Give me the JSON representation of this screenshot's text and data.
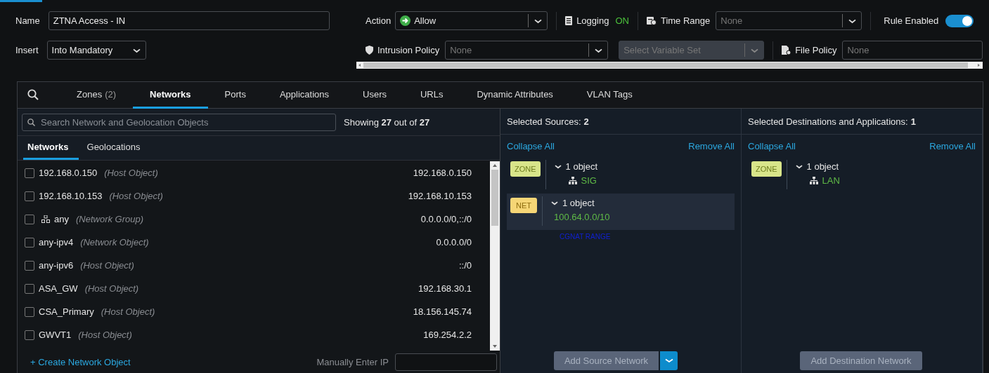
{
  "rule": {
    "name_label": "Name",
    "name": "ZTNA Access - IN",
    "insert_label": "Insert",
    "insert": "Into Mandatory",
    "action_label": "Action",
    "action": "Allow",
    "logging_label": "Logging",
    "logging": "ON",
    "time_range_label": "Time Range",
    "time_range_placeholder": "None",
    "rule_enabled_label": "Rule Enabled",
    "rule_enabled": true,
    "intrusion_label": "Intrusion Policy",
    "intrusion_placeholder": "None",
    "variable_set_placeholder": "Select Variable Set",
    "file_policy_label": "File Policy",
    "file_policy_placeholder": "None"
  },
  "tabs": [
    {
      "label": "Zones",
      "count": "(2)",
      "selected": false
    },
    {
      "label": "Networks",
      "selected": true
    },
    {
      "label": "Ports",
      "selected": false
    },
    {
      "label": "Applications",
      "selected": false
    },
    {
      "label": "Users",
      "selected": false
    },
    {
      "label": "URLs",
      "selected": false
    },
    {
      "label": "Dynamic Attributes",
      "selected": false
    },
    {
      "label": "VLAN Tags",
      "selected": false
    }
  ],
  "search": {
    "placeholder": "Search Network and Geolocation Objects"
  },
  "showing": "Showing **27** out of **27**",
  "subtabs": [
    {
      "label": "Networks",
      "selected": true
    },
    {
      "label": "Geolocations",
      "selected": false
    }
  ],
  "objects": [
    {
      "kind": "host",
      "name": "192.168.0.150",
      "type": "(Host Object)",
      "value": "192.168.0.150",
      "checked": false
    },
    {
      "kind": "host",
      "name": "192.168.10.153",
      "type": "(Host Object)",
      "value": "192.168.10.153",
      "checked": false
    },
    {
      "kind": "group",
      "name": "any",
      "type": "(Network Group)",
      "value": "0.0.0.0/0,::/0",
      "checked": false
    },
    {
      "kind": "host",
      "name": "any-ipv4",
      "type": "(Network Object)",
      "value": "0.0.0.0/0",
      "checked": false
    },
    {
      "kind": "host",
      "name": "any-ipv6",
      "type": "(Host Object)",
      "value": "::/0",
      "checked": false
    },
    {
      "kind": "host",
      "name": "ASA_GW",
      "type": "(Host Object)",
      "value": "192.168.30.1",
      "checked": false
    },
    {
      "kind": "host",
      "name": "CSA_Primary",
      "type": "(Host Object)",
      "value": "18.156.145.74",
      "checked": false
    },
    {
      "kind": "host",
      "name": "GWVT1",
      "type": "(Host Object)",
      "value": "169.254.2.2",
      "checked": false
    }
  ],
  "create_link": "+ Create Network Object",
  "manual_ip_label": "Manually Enter IP",
  "sources": {
    "title": "Selected Sources: **2**",
    "collapse": "Collapse All",
    "remove": "Remove All",
    "groups": [
      {
        "kind": "zone",
        "tag": "ZONE",
        "header": "1 object",
        "selected": false,
        "items": [
          {
            "kind": "zone",
            "label": "SIG"
          }
        ]
      },
      {
        "kind": "net",
        "tag": "NET",
        "header": "1 object",
        "selected": true,
        "items": [
          {
            "kind": "net",
            "label": "100.64.0.0/10"
          }
        ]
      }
    ],
    "note": "CGNAT RANGE",
    "add_button": "Add Source Network",
    "has_dropdown": true
  },
  "destinations": {
    "title": "Selected Destinations and Applications: **1**",
    "collapse": "Collapse All",
    "remove": "Remove All",
    "groups": [
      {
        "kind": "zone",
        "tag": "ZONE",
        "header": "1 object",
        "selected": false,
        "items": [
          {
            "kind": "zone",
            "label": "LAN"
          }
        ]
      }
    ],
    "add_button": "Add Destination Network",
    "has_dropdown": false
  }
}
